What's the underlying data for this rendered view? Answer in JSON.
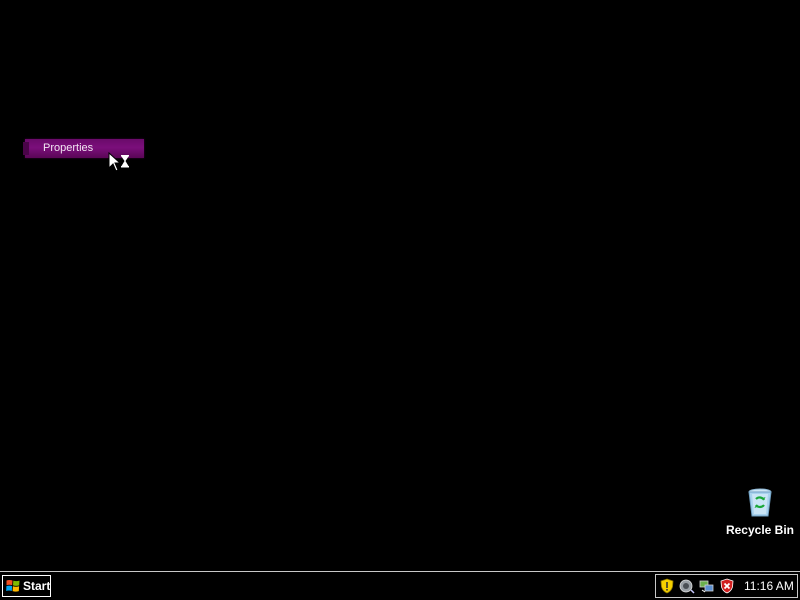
{
  "context_menu": {
    "items": [
      {
        "label": "Properties"
      }
    ],
    "highlight_color": "#7b0f7b"
  },
  "cursor": {
    "icon": "arrow-busy-hourglass-cursor"
  },
  "desktop": {
    "background_color": "#000000",
    "icons": [
      {
        "label": "Recycle Bin",
        "icon": "recycle-bin-icon"
      }
    ]
  },
  "taskbar": {
    "start_label": "Start",
    "tray_icons": [
      "security-shield-icon",
      "speaker-icon",
      "network-icon",
      "security-alert-icon"
    ],
    "clock": "11:16 AM"
  }
}
